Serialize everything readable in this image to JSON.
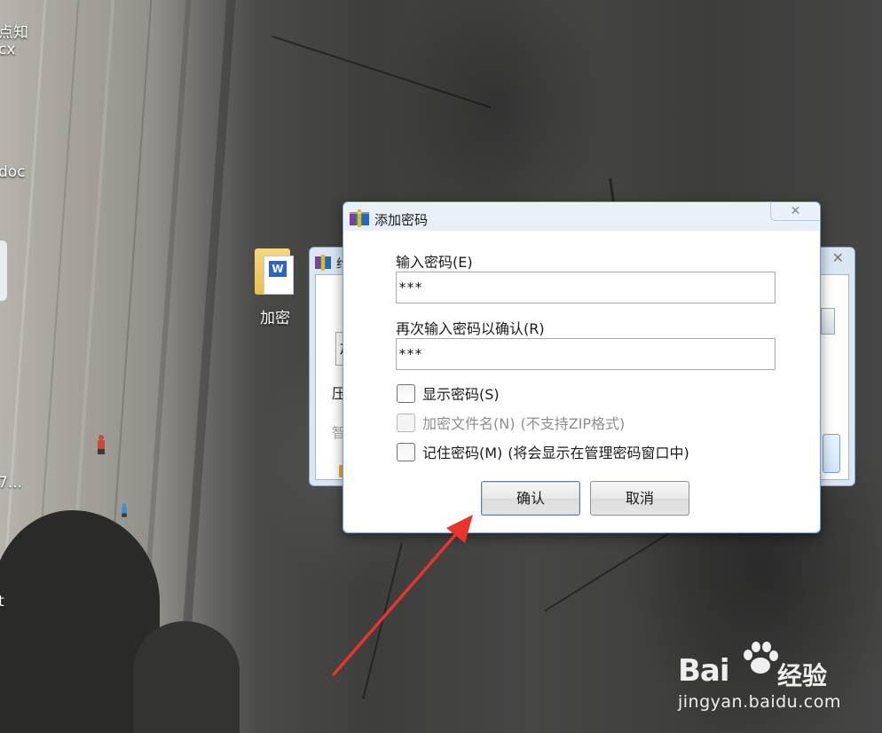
{
  "desktop": {
    "left_labels": [
      "点知",
      "cx",
      "doc",
      "7...",
      "t"
    ],
    "file_icon_label": "加密",
    "watermark": {
      "brand": "Bai",
      "product": "经验",
      "url": "jingyan.baidu.com"
    }
  },
  "background_window": {
    "title_fragment": "约",
    "input_fragment": "加",
    "label_compress": "压",
    "label_smart": "智"
  },
  "dialog": {
    "title": "添加密码",
    "close_glyph": "✕",
    "password_label": "输入密码(E)",
    "password_value": "***",
    "confirm_label": "再次输入密码以确认(R)",
    "confirm_value": "***",
    "show_password": {
      "label": "显示密码(S)",
      "checked": false,
      "enabled": true
    },
    "encrypt_filenames": {
      "label": "加密文件名(N)",
      "note": "(不支持ZIP格式)",
      "checked": false,
      "enabled": false
    },
    "remember_password": {
      "label": "记住密码(M)",
      "note": "(将会显示在管理密码窗口中)",
      "checked": false,
      "enabled": true
    },
    "ok_button": "确认",
    "cancel_button": "取消"
  },
  "colors": {
    "arrow": "#e8342b",
    "dialog_frame": "#dbe6f2",
    "accent": "#2b65c4"
  }
}
